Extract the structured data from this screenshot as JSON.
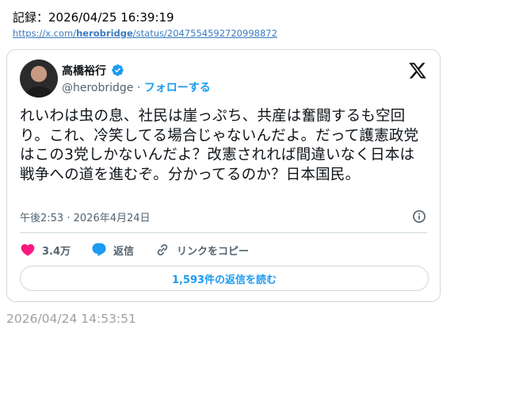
{
  "header": {
    "record_line": "記録：2026/04/25 16:39:19",
    "url_prefix": "https://x.com/",
    "url_user": "herobridge",
    "url_suffix": "/status/2047554592720998872"
  },
  "tweet": {
    "author_name": "高橋裕行",
    "handle": "@herobridge",
    "separator": "·",
    "follow_label": "フォローする",
    "text": "れいわは虫の息、社民は崖っぷち、共産は奮闘するも空回り。これ、冷笑してる場合じゃないんだよ。だって護憲政党はこの3党しかないんだよ？改憲されれば間違いなく日本は戦争への道を進むぞ。分かってるのか？日本国民。",
    "time": "午後2:53",
    "date_separator": "·",
    "date": "2026年4月24日",
    "likes": "3.4万",
    "reply_label": "返信",
    "copy_link_label": "リンクをコピー",
    "read_replies_label": "1,593件の返信を読む"
  },
  "footer": {
    "timestamp": "2026/04/24 14:53:51"
  },
  "icons": {
    "verified": "verified-badge-icon",
    "x_logo": "x-logo-icon",
    "info": "info-icon",
    "like": "heart-icon",
    "reply": "speech-bubble-icon",
    "link": "link-icon"
  },
  "colors": {
    "accent": "#1d9bf0",
    "like": "#f91880",
    "muted": "#536471",
    "border": "#cfd9de",
    "url": "#3a7bbf"
  }
}
